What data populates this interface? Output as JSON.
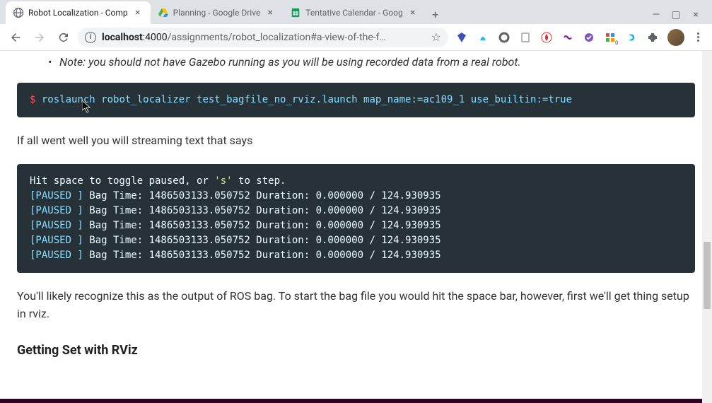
{
  "tabs": [
    {
      "title": "Robot Localization - Comp",
      "favicon": "globe"
    },
    {
      "title": "Planning - Google Drive",
      "favicon": "drive"
    },
    {
      "title": "Tentative Calendar - Goog",
      "favicon": "sheets"
    }
  ],
  "url": {
    "host": "localhost",
    "port": ":4000",
    "path": "/assignments/robot_localization#a-view-of-the-f…"
  },
  "content": {
    "note": "Note: you should not have Gazebo running as you will be using recorded data from a real robot.",
    "cmd_prompt": "$",
    "cmd": "roslaunch robot_localizer test_bagfile_no_rviz.launch map_name:=ac109_1 use_builtin:=true",
    "para1": "If all went well you will streaming text that says",
    "output_lines": [
      [
        "Hit space to toggle paused, or ",
        "'s'",
        " to step."
      ],
      [
        "[PAUSED ]",
        "  Bag Time: 1486503133.050752   Duration: 0.000000 / 124.930935"
      ],
      [
        "[PAUSED ]",
        "  Bag Time: 1486503133.050752   Duration: 0.000000 / 124.930935"
      ],
      [
        "[PAUSED ]",
        "  Bag Time: 1486503133.050752   Duration: 0.000000 / 124.930935"
      ],
      [
        "[PAUSED ]",
        "  Bag Time: 1486503133.050752   Duration: 0.000000 / 124.930935"
      ],
      [
        "[PAUSED ]",
        "  Bag Time: 1486503133.050752   Duration: 0.000000 / 124.930935"
      ]
    ],
    "para2": "You'll likely recognize this as the output of ROS bag. To start the bag file you would hit the space bar, however, first we'll get thing setup in rviz.",
    "heading": "Getting Set with RViz"
  },
  "ext_badge": "0"
}
